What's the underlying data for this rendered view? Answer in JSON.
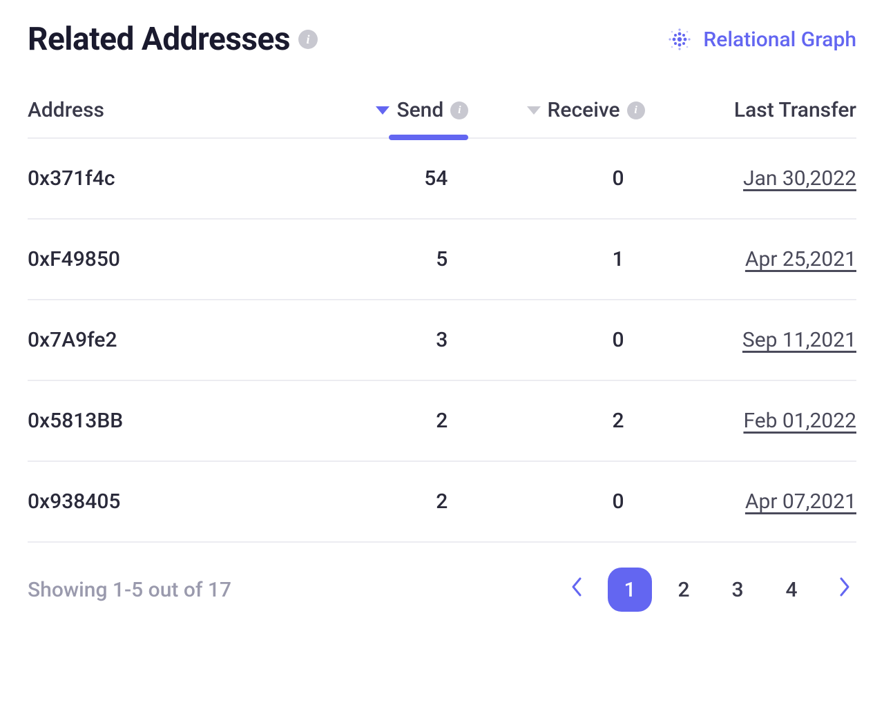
{
  "header": {
    "title": "Related Addresses",
    "graph_link": "Relational Graph"
  },
  "columns": {
    "address": "Address",
    "send": "Send",
    "receive": "Receive",
    "last_transfer": "Last Transfer"
  },
  "rows": [
    {
      "address": "0x371f4c",
      "send": "54",
      "receive": "0",
      "last_transfer": "Jan 30,2022"
    },
    {
      "address": "0xF49850",
      "send": "5",
      "receive": "1",
      "last_transfer": "Apr 25,2021"
    },
    {
      "address": "0x7A9fe2",
      "send": "3",
      "receive": "0",
      "last_transfer": "Sep 11,2021"
    },
    {
      "address": "0x5813BB",
      "send": "2",
      "receive": "2",
      "last_transfer": "Feb 01,2022"
    },
    {
      "address": "0x938405",
      "send": "2",
      "receive": "0",
      "last_transfer": "Apr 07,2021"
    }
  ],
  "pagination": {
    "showing": "Showing 1-5 out of 17",
    "pages": [
      "1",
      "2",
      "3",
      "4"
    ],
    "active_page": "1"
  }
}
